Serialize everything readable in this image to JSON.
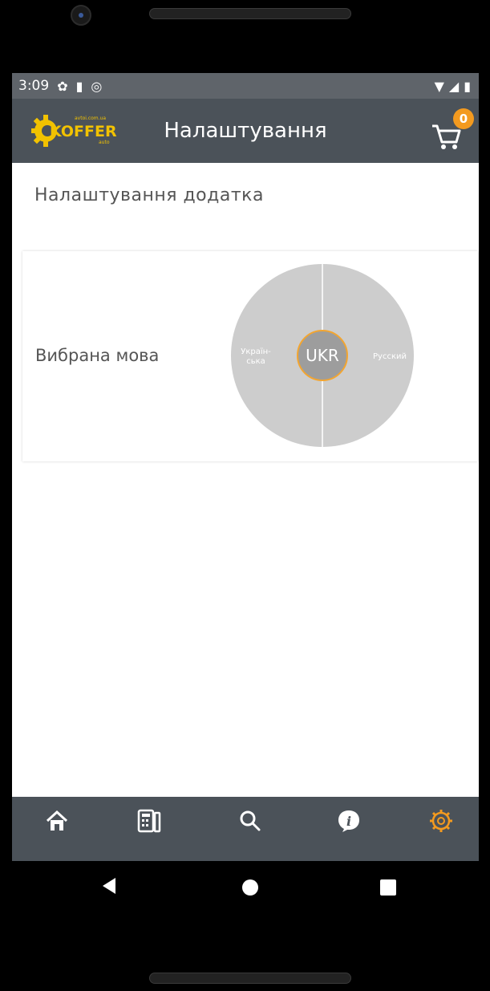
{
  "status": {
    "time": "3:09"
  },
  "appbar": {
    "title": "Налаштування",
    "logo_text": "KOFFER",
    "logo_subtext": "auto",
    "logo_url_text": "avtoi.com.ua",
    "cart_count": "0"
  },
  "section_title": "Налаштування додатка",
  "language": {
    "label": "Вибрана мова",
    "left_option": "Україн-\nська",
    "right_option": "Русский",
    "selected": "UKR"
  },
  "colors": {
    "bars": "#4b5259",
    "accent": "#f39a1f"
  },
  "bottom_nav": [
    {
      "icon": "home-icon"
    },
    {
      "icon": "catalog-icon"
    },
    {
      "icon": "search-icon"
    },
    {
      "icon": "info-icon"
    },
    {
      "icon": "settings-icon",
      "active": true
    }
  ]
}
